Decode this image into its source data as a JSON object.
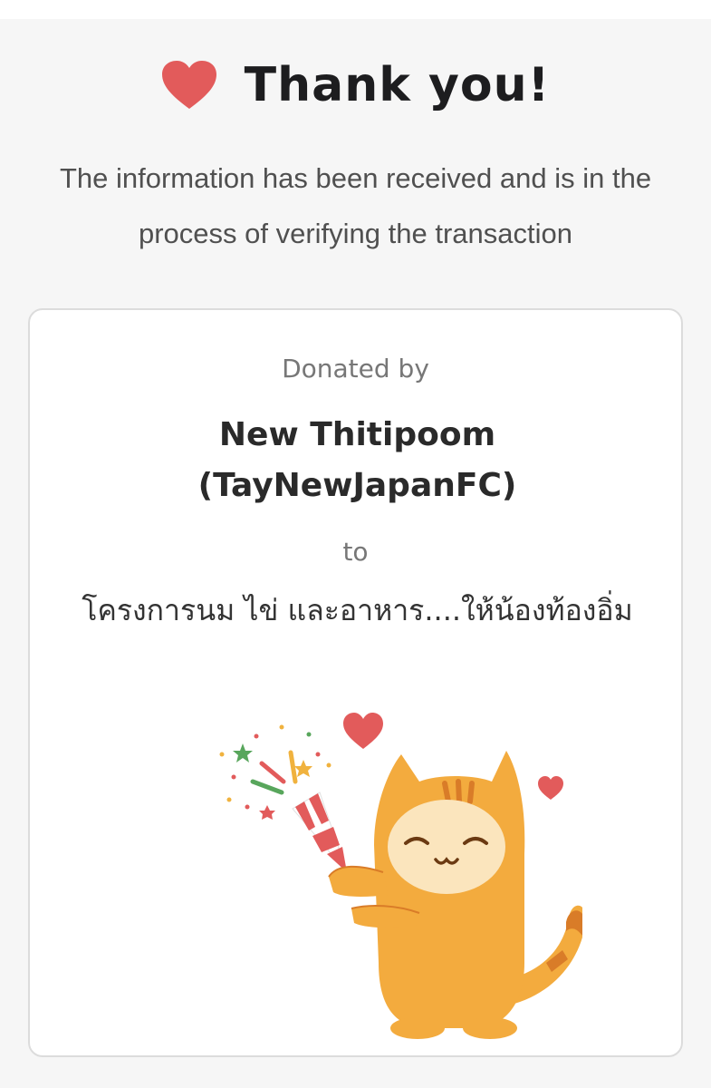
{
  "header": {
    "icon": "heart-icon",
    "title": "Thank  you!",
    "accent_color": "#e25b5b"
  },
  "subtitle": "The information has been received and is in the process of verifying the transaction",
  "card": {
    "donated_label": "Donated  by",
    "donor_name": "New  Thitipoom (TayNewJapanFC)",
    "to_label": "to",
    "project_name": "โครงการนม ไข่ และอาหาร....ให้น้องท้องอิ่ม",
    "illustration": "cat-celebrating-with-party-popper-illustration",
    "cat_color": "#f3ab3e"
  }
}
